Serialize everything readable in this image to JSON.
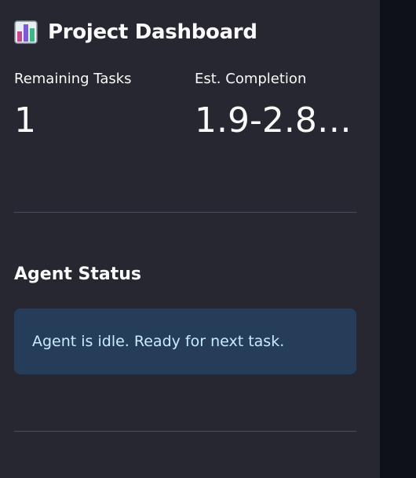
{
  "sidebar": {
    "title": "Project Dashboard",
    "title_icon": "bar-chart-icon",
    "metrics": [
      {
        "label": "Remaining Tasks",
        "value": "1"
      },
      {
        "label": "Est. Completion",
        "value": "1.9-2.8…"
      }
    ],
    "agent_status": {
      "heading": "Agent Status",
      "message": "Agent is idle. Ready for next task."
    }
  },
  "colors": {
    "sidebar_bg": "#262730",
    "main_bg": "#0e1117",
    "info_bg": "#263d5a",
    "info_text": "#c7ebff"
  }
}
